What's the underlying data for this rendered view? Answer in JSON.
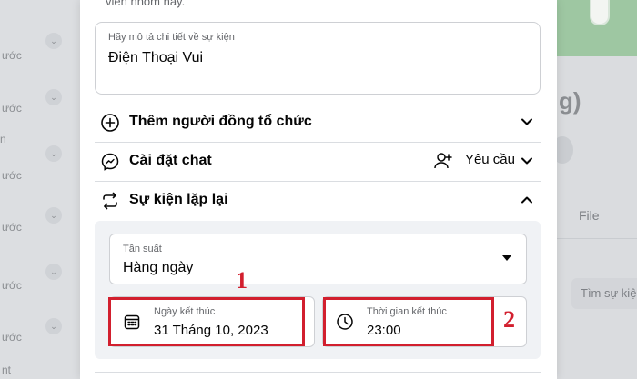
{
  "background": {
    "left_items": [
      "ước",
      "ước",
      "n",
      "ước",
      "ước",
      "ước",
      "ước",
      "nt"
    ],
    "right_paren": "g)",
    "right_tab": "File",
    "right_search": "Tìm sự kiệ"
  },
  "modal": {
    "top_text": "viên nhóm này.",
    "description": {
      "label": "Hãy mô tả chi tiết về sự kiện",
      "value": "Điện Thoại Vui"
    },
    "rows": {
      "cohost": "Thêm người đồng tổ chức",
      "chat_settings": "Cài đặt chat",
      "chat_request": "Yêu cầu",
      "repeat": "Sự kiện lặp lại"
    },
    "frequency": {
      "label": "Tần suất",
      "value": "Hàng ngày"
    },
    "end_date": {
      "label": "Ngày kết thúc",
      "value": "31 Tháng 10, 2023"
    },
    "end_time": {
      "label": "Thời gian kết thúc",
      "value": "23:00"
    }
  },
  "annotations": {
    "first": "1",
    "second": "2"
  },
  "colors": {
    "highlight": "#d21f2e",
    "panel": "#f0f2f5",
    "border": "#ced0d4"
  }
}
